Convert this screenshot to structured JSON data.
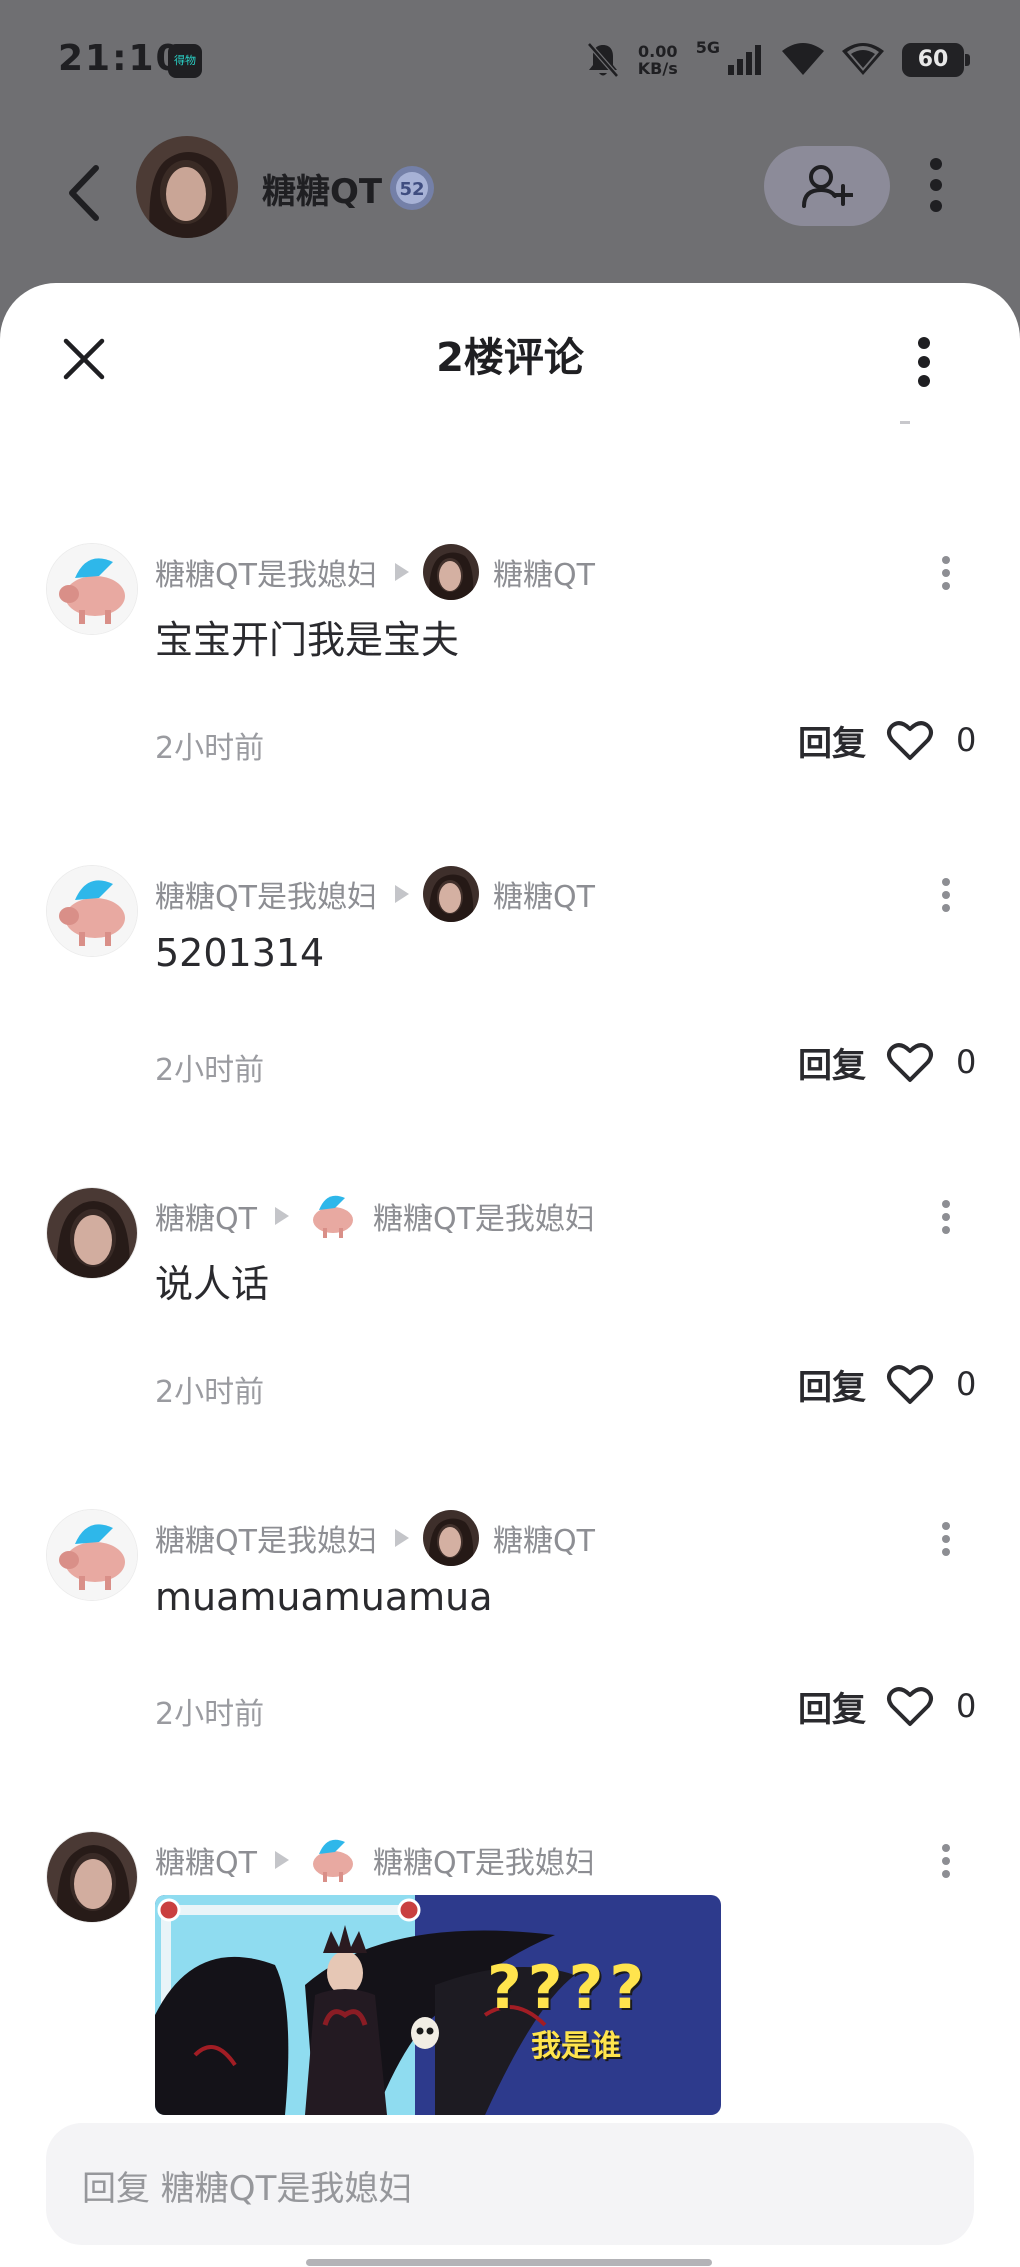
{
  "status_bar": {
    "time": "21:10",
    "app_badge": "得物",
    "net_speed_value": "0.00",
    "net_speed_unit": "KB/s",
    "signal_label": "5G",
    "battery": "60"
  },
  "header": {
    "username": "糖糖QT",
    "level": "52"
  },
  "sheet": {
    "title": "2楼评论"
  },
  "comments": [
    {
      "author": "糖糖QT是我媳妇",
      "reply_to": "糖糖QT",
      "text": "宝宝开门我是宝夫",
      "time": "2小时前",
      "reply_label": "回复",
      "likes": "0"
    },
    {
      "author": "糖糖QT是我媳妇",
      "reply_to": "糖糖QT",
      "text": "5201314",
      "time": "2小时前",
      "reply_label": "回复",
      "likes": "0"
    },
    {
      "author": "糖糖QT",
      "reply_to": "糖糖QT是我媳妇",
      "text": "说人话",
      "time": "2小时前",
      "reply_label": "回复",
      "likes": "0"
    },
    {
      "author": "糖糖QT是我媳妇",
      "reply_to": "糖糖QT",
      "text": "muamuamuamua",
      "time": "2小时前",
      "reply_label": "回复",
      "likes": "0"
    },
    {
      "author": "糖糖QT",
      "reply_to": "糖糖QT是我媳妇",
      "image_text_marks": "????",
      "image_text": "我是谁"
    }
  ],
  "reply_bar": {
    "placeholder": "回复 糖糖QT是我媳妇"
  },
  "colors": {
    "dim_background": "#6f6f72",
    "sheet_background": "#ffffff",
    "meta_text": "#8d8e93",
    "body_text": "#2a2a2e",
    "follow_button": "#8c8b99",
    "image_banner_blue": "#2d3a8c",
    "image_frame_cyan": "#8fdcf0"
  },
  "icons": [
    "back-arrow-icon",
    "user-plus-icon",
    "more-vertical-icon",
    "close-icon",
    "heart-outline-icon",
    "mute-icon",
    "wifi-icon",
    "signal-icon"
  ]
}
